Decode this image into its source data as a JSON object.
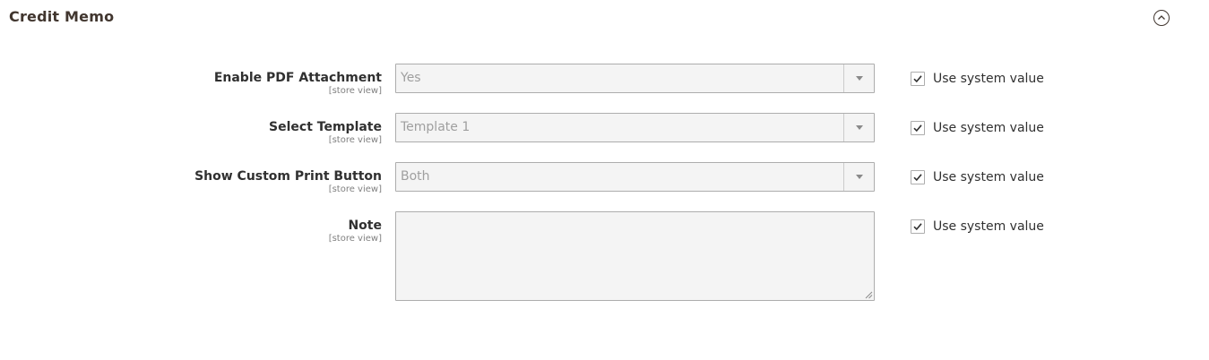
{
  "section": {
    "title": "Credit Memo",
    "toggle_icon": "chevron-up-circle-icon"
  },
  "fields": [
    {
      "label": "Enable PDF Attachment",
      "scope": "[store view]",
      "type": "select",
      "value": "Yes",
      "use_system_value_label": "Use system value",
      "use_system_value_checked": true
    },
    {
      "label": "Select Template",
      "scope": "[store view]",
      "type": "select",
      "value": "Template 1",
      "use_system_value_label": "Use system value",
      "use_system_value_checked": true
    },
    {
      "label": "Show Custom Print Button",
      "scope": "[store view]",
      "type": "select",
      "value": "Both",
      "use_system_value_label": "Use system value",
      "use_system_value_checked": true
    },
    {
      "label": "Note",
      "scope": "[store view]",
      "type": "textarea",
      "value": "",
      "use_system_value_label": "Use system value",
      "use_system_value_checked": true
    }
  ],
  "colors": {
    "disabled_background": "#f4f4f4",
    "border": "#adadad",
    "label": "#303030",
    "scope": "#808080",
    "placeholder_text": "#9f9f9f"
  }
}
